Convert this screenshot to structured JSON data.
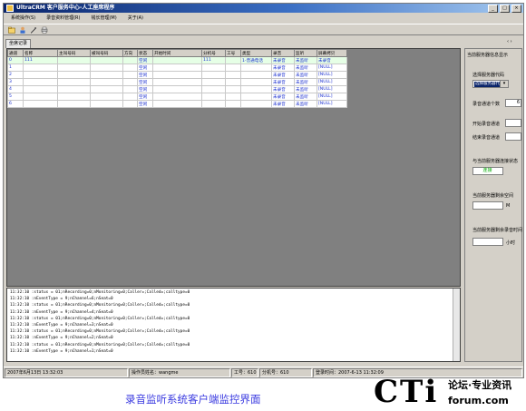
{
  "window": {
    "title": "UltraCRM 客户服务中心-人工座席程序",
    "controls": [
      "_",
      "□",
      "×"
    ]
  },
  "menu": [
    "系统操作(S)",
    "录音资料管理(R)",
    "钱长管理(M)",
    "关于(A)"
  ],
  "toolbar_icons": [
    "open-icon",
    "user-icon",
    "tools-icon",
    "print-icon"
  ],
  "tab_label": "坐席记录",
  "tab_arrows": "‹ ›",
  "table": {
    "headers": [
      "通道",
      "名称",
      "主叫号码",
      "被叫号码",
      "方向",
      "状态",
      "开始时间",
      "分机号",
      "工号",
      "类型",
      "录音",
      "监听",
      "屏幕拷贝"
    ],
    "rows": [
      [
        "0",
        "111",
        "",
        "",
        "",
        "空闲",
        "",
        "111",
        "",
        "1-普通电话",
        "未录音",
        "未监听",
        "未录音"
      ],
      [
        "1",
        "",
        "",
        "",
        "",
        "空闲",
        "",
        "",
        "",
        "",
        "未录音",
        "未监听",
        "[NULL]"
      ],
      [
        "2",
        "",
        "",
        "",
        "",
        "空闲",
        "",
        "",
        "",
        "",
        "未录音",
        "未监听",
        "[NULL]"
      ],
      [
        "3",
        "",
        "",
        "",
        "",
        "空闲",
        "",
        "",
        "",
        "",
        "未录音",
        "未监听",
        "[NULL]"
      ],
      [
        "4",
        "",
        "",
        "",
        "",
        "空闲",
        "",
        "",
        "",
        "",
        "未录音",
        "未监听",
        "[NULL]"
      ],
      [
        "5",
        "",
        "",
        "",
        "",
        "空闲",
        "",
        "",
        "",
        "",
        "未录音",
        "未监听",
        "[NULL]"
      ],
      [
        "6",
        "",
        "",
        "",
        "",
        "空闲",
        "",
        "",
        "",
        "",
        "未录音",
        "未监听",
        "[NULL]"
      ]
    ]
  },
  "log_lines": [
    "11:32:10  :status = 01;nRecording=0;nMonitoring=0;Caller=;Called=;calltype=0",
    "11:32:10  :nEventType = 9;nChannel=6;nSeat=0",
    "11:32:10  :status = 01;nRecording=0;nMonitoring=0;Caller=;Called=;calltype=0",
    "11:32:10  :nEventType = 9;nChannel=4;nSeat=0",
    "11:32:10  :status = 01;nRecording=0;nMonitoring=0;Caller=;Called=;calltype=0",
    "11:32:10  :nEventType = 9;nChannel=3;nSeat=0",
    "11:32:10  :status = 01;nRecording=0;nMonitoring=0;Caller=;Called=;calltype=0",
    "11:32:10  :nEventType = 9;nChannel=2;nSeat=0",
    "11:32:10  :status = 01;nRecording=0;nMonitoring=0;Caller=;Called=;calltype=0",
    "11:32:10  :nEventType = 9;nChannel=1;nSeat=0"
  ],
  "panel": {
    "header": "当前服务器信息显示",
    "server_code_label": "选择服务器代码",
    "server_code_value": "选择服务器代码",
    "channel_count_label": "录音通道个数",
    "channel_count": "6",
    "start_channel_label": "开始录音通道",
    "end_channel_label": "结束录音通道",
    "conn_status_label": "与当前服务器连接状态",
    "conn_status": "连接",
    "disk_space_label": "当前服务器剩余空间",
    "disk_space_unit": "M",
    "remaining_time_label": "当前服务器剩余录音时间",
    "remaining_time_unit": "小时"
  },
  "status_bar": {
    "datetime": "2007年6月13日 13:32:03",
    "operator": "操作员姓名：wangme",
    "worker_id": "工号：610",
    "extension": "分机号：610",
    "login_time": "登录时间：2007-6-13 11:32:09"
  },
  "caption": "录音监听系统客户端监控界面",
  "watermark": {
    "brand": "CTi",
    "line1": "论坛·专业资讯",
    "line2": "forum.com"
  },
  "colors": {
    "title_start": "#0a246a",
    "link_blue": "#1a2fd0",
    "status_green": "#00aa00"
  }
}
